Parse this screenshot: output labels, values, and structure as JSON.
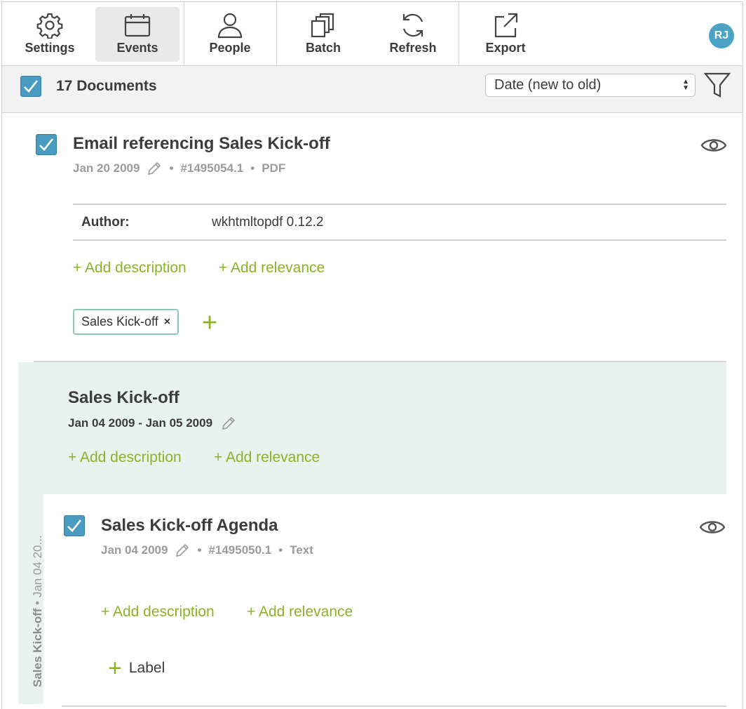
{
  "toolbar": {
    "settings": "Settings",
    "events": "Events",
    "people": "People",
    "batch": "Batch",
    "refresh": "Refresh",
    "export": "Export",
    "avatar_initials": "RJ"
  },
  "filterbar": {
    "count": "17 Documents",
    "sort_value": "Date (new to old)"
  },
  "doc1": {
    "title": "Email referencing Sales Kick-off",
    "date": "Jan 20 2009",
    "id": "#1495054.1",
    "type": "PDF",
    "author_key": "Author:",
    "author_val": "wkhtmltopdf 0.12.2",
    "add_description": "+ Add description",
    "add_relevance": "+ Add relevance",
    "tag": "Sales Kick-off",
    "tag_remove": "×",
    "add_tag": "+"
  },
  "event": {
    "title": "Sales Kick-off",
    "dates": "Jan 04 2009 - Jan 05 2009",
    "add_description": "+ Add description",
    "add_relevance": "+ Add relevance",
    "side_name": "Sales Kick-off",
    "side_rest": " • Jan 04 20..."
  },
  "doc2": {
    "title": "Sales Kick-off Agenda",
    "date": "Jan 04 2009",
    "id": "#1495050.1",
    "type": "Text",
    "add_description": "+ Add description",
    "add_relevance": "+ Add relevance",
    "label_plus": "+",
    "label": "Label"
  },
  "meta_sep": "•",
  "colors": {
    "accent_green": "#8cb326",
    "checkbox_blue": "#4a9bc2",
    "event_bg": "#e8f3ef",
    "avatar": "#4aa3c4"
  }
}
